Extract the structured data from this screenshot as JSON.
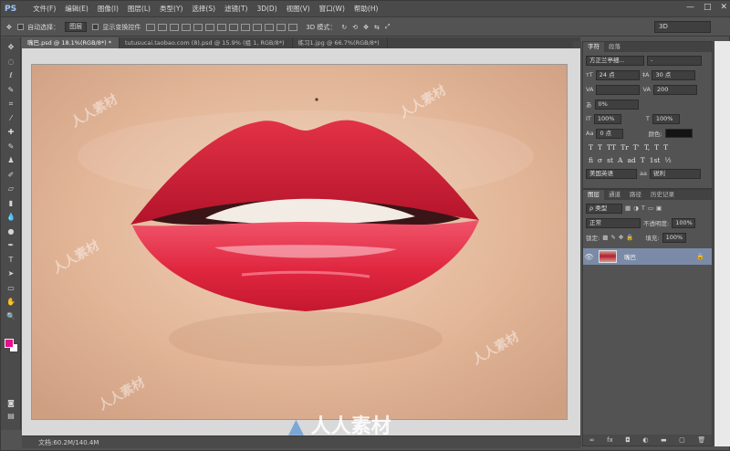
{
  "app": {
    "logo": "PS"
  },
  "menu": [
    "文件(F)",
    "编辑(E)",
    "图像(I)",
    "图层(L)",
    "类型(Y)",
    "选择(S)",
    "滤镜(T)",
    "3D(D)",
    "视图(V)",
    "窗口(W)",
    "帮助(H)"
  ],
  "window_controls": {
    "minimize": "—",
    "maximize": "□",
    "close": "✕"
  },
  "options": {
    "autoselect_label": "自动选择：",
    "autoselect_value": "图层",
    "show_transform": "显示变换控件",
    "mode_3d": "3D 模式：",
    "workspace": "3D"
  },
  "tabs": [
    {
      "label": "嘴巴.psd @ 18.1%(RGB/8*) *"
    },
    {
      "label": "tutusucai.taobao.com (8).psd @ 15.9% (组 1, RGB/8*)"
    },
    {
      "label": "练习1.jpg @ 66.7%(RGB/8*)"
    }
  ],
  "watermark_text": "人人素材",
  "status": {
    "doc": "文档:60.2M/140.4M"
  },
  "character_panel": {
    "tabs": [
      "字符",
      "段落"
    ],
    "font_family": "方正兰亭细...",
    "font_style": "-",
    "font_size": "24 点",
    "leading": "30 点",
    "kerning": "",
    "tracking": "200",
    "scale_percent": "0%",
    "vertical_scale": "100%",
    "horizontal_scale": "100%",
    "baseline": "0 点",
    "color_label": "颜色:",
    "typo_buttons": [
      "T",
      "T",
      "TT",
      "Tr",
      "T'",
      "T,",
      "T",
      "T"
    ],
    "opentype_buttons": [
      "fi",
      "σ",
      "st",
      "A",
      "ad",
      "T",
      "1st",
      "½"
    ],
    "language": "美国英语",
    "antialias_label": "aa",
    "antialias": "锐利"
  },
  "layers_panel": {
    "tabs": [
      "图层",
      "通道",
      "路径",
      "历史记录"
    ],
    "filter_kind": "ρ 类型",
    "blend_mode": "正常",
    "opacity_label": "不透明度:",
    "opacity": "100%",
    "lock_label": "锁定:",
    "fill_label": "填充:",
    "fill": "100%",
    "layers": [
      {
        "name": "嘴巴",
        "visible": true,
        "locked": true
      }
    ]
  },
  "colors": {
    "foreground": "#e60e8c",
    "background": "#ffffff",
    "accent": "#7b8ba7"
  }
}
